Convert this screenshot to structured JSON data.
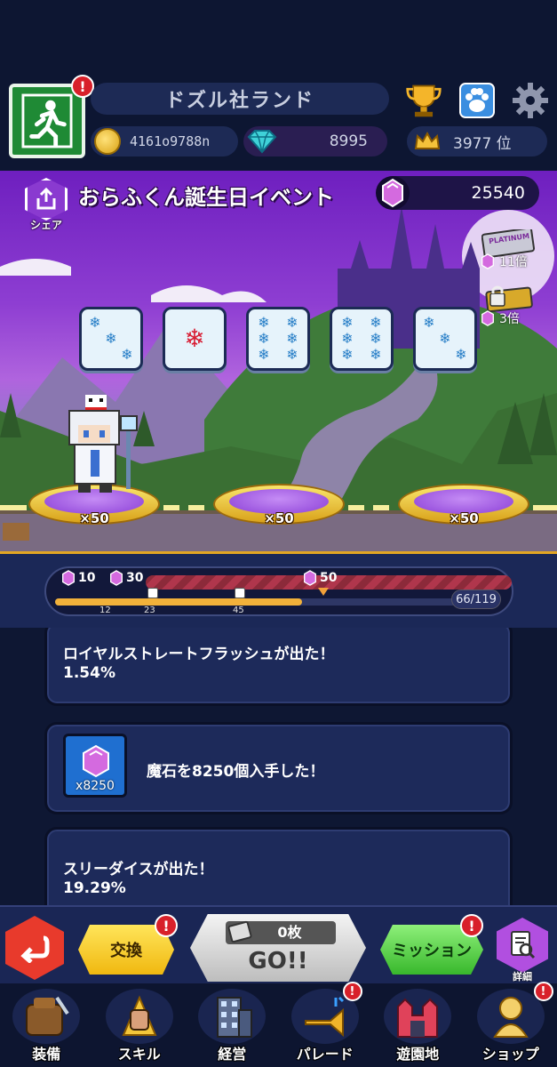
{
  "header": {
    "park_name": "ドズル社ランド",
    "coins": "4161o9788n",
    "gems": "8995",
    "rank": "3977 位",
    "alert": "!"
  },
  "event": {
    "share_label": "シェア",
    "title": "おらふくん誕生日イベント",
    "stones": "25540",
    "platinum_label": "PLATINUM",
    "multiplier_platinum": "11倍",
    "multiplier_locked": "3倍",
    "dice_faces": [
      3,
      1,
      6,
      6,
      3
    ],
    "platform_rewards": [
      "×50",
      "×50",
      "×50"
    ]
  },
  "progress": {
    "milestones": [
      {
        "label": "10"
      },
      {
        "label": "30"
      },
      {
        "label": "50"
      }
    ],
    "tick_labels": [
      "12",
      "23",
      "45"
    ],
    "current": 66,
    "total": 119,
    "count_text": "66/119"
  },
  "log": {
    "entry1_title": "ロイヤルストレートフラッシュが出た！",
    "entry1_value": "1.54%",
    "entry2_text": "魔石を8250個入手した！",
    "entry2_qty": "x8250",
    "entry3_title": "スリーダイスが出た！",
    "entry3_value": "19.29%"
  },
  "actions": {
    "exchange": "交換",
    "tickets": "0枚",
    "go": "GO!!",
    "mission": "ミッション",
    "detail": "詳細",
    "alert": "!"
  },
  "nav": {
    "items": [
      "装備",
      "スキル",
      "経営",
      "パレード",
      "遊園地",
      "ショップ"
    ]
  },
  "colors": {
    "background": "#0e1733",
    "accent_gold": "#f2b13a",
    "event_purple": "#8e3ed2",
    "alert_red": "#d8202a"
  }
}
